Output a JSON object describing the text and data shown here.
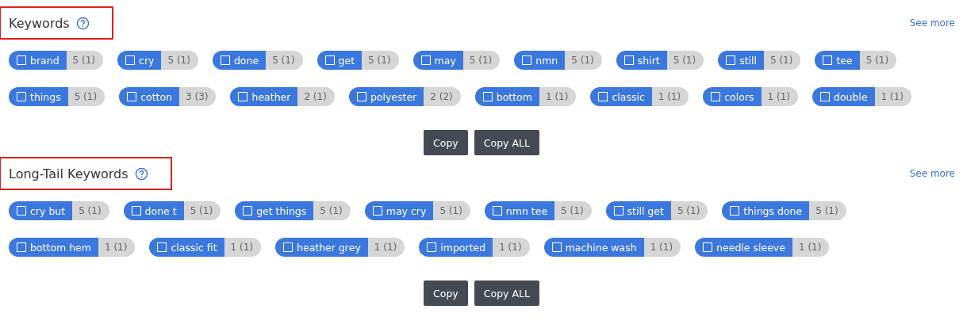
{
  "sections": [
    {
      "title": "Keywords",
      "highlighted": true,
      "see_more": "See more",
      "tags": [
        {
          "label": "brand",
          "count": "5 (1)",
          "checked": false
        },
        {
          "label": "cry",
          "count": "5 (1)",
          "checked": false
        },
        {
          "label": "done",
          "count": "5 (1)",
          "checked": false
        },
        {
          "label": "get",
          "count": "5 (1)",
          "checked": false
        },
        {
          "label": "may",
          "count": "5 (1)",
          "checked": false
        },
        {
          "label": "nmn",
          "count": "5 (1)",
          "checked": false
        },
        {
          "label": "shirt",
          "count": "5 (1)",
          "checked": false
        },
        {
          "label": "still",
          "count": "5 (1)",
          "checked": false
        },
        {
          "label": "tee",
          "count": "5 (1)",
          "checked": false
        },
        {
          "label": "things",
          "count": "5 (1)",
          "checked": false
        },
        {
          "label": "cotton",
          "count": "3 (3)",
          "checked": false
        },
        {
          "label": "heather",
          "count": "2 (1)",
          "checked": false
        },
        {
          "label": "polyester",
          "count": "2 (2)",
          "checked": false
        },
        {
          "label": "bottom",
          "count": "1 (1)",
          "checked": false
        },
        {
          "label": "classic",
          "count": "1 (1)",
          "checked": false
        },
        {
          "label": "colors",
          "count": "1 (1)",
          "checked": false
        },
        {
          "label": "double",
          "count": "1 (1)",
          "checked": false
        }
      ],
      "buttons": [
        "Copy",
        "Copy ALL"
      ]
    },
    {
      "title": "Long-Tail Keywords",
      "highlighted": true,
      "see_more": "See more",
      "tags": [
        {
          "label": "cry but",
          "count": "5 (1)",
          "checked": false
        },
        {
          "label": "done t",
          "count": "5 (1)",
          "checked": false
        },
        {
          "label": "get things",
          "count": "5 (1)",
          "checked": false
        },
        {
          "label": "may cry",
          "count": "5 (1)",
          "checked": false
        },
        {
          "label": "nmn tee",
          "count": "5 (1)",
          "checked": false
        },
        {
          "label": "still get",
          "count": "5 (1)",
          "checked": false
        },
        {
          "label": "things done",
          "count": "5 (1)",
          "checked": false
        },
        {
          "label": "bottom hem",
          "count": "1 (1)",
          "checked": false
        },
        {
          "label": "classic fit",
          "count": "1 (1)",
          "checked": false
        },
        {
          "label": "heather grey",
          "count": "1 (1)",
          "checked": false
        },
        {
          "label": "imported",
          "count": "1 (1)",
          "checked": false
        },
        {
          "label": "machine wash",
          "count": "1 (1)",
          "checked": false
        },
        {
          "label": "needle sleeve",
          "count": "1 (1)",
          "checked": false
        }
      ],
      "buttons": [
        "Copy",
        "Copy ALL"
      ]
    }
  ]
}
